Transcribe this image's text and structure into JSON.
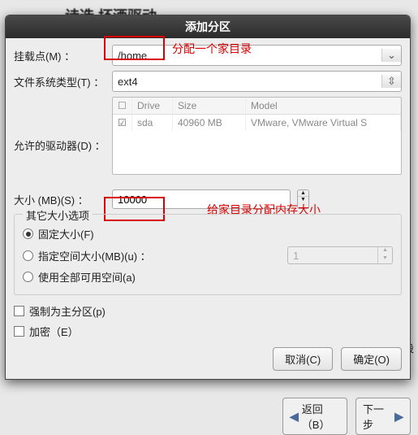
{
  "background": {
    "truncated_title": "诗选 坏酒驱动",
    "back_btn": "返回（B）",
    "next_btn": "下一步",
    "side_label": "设"
  },
  "dialog": {
    "title": "添加分区",
    "mount_label": "挂载点(M) ：",
    "mount_value": "/home",
    "annot_mount": "分配一个家目录",
    "fs_label": "文件系统类型(T) ：",
    "fs_value": "ext4",
    "drives_label": "允许的驱动器(D) ：",
    "drive_table": {
      "head": {
        "c1": "Drive",
        "c2": "Size",
        "c3": "Model"
      },
      "row": {
        "c1": "sda",
        "c2": "40960 MB",
        "c3": "VMware, VMware Virtual S"
      }
    },
    "size_label": "大小 (MB)(S) ：",
    "size_value": "10000",
    "annot_size": "给家目录分配内存大小",
    "size_group": {
      "legend": "其它大小选项",
      "opt_fixed": "固定大小(F)",
      "opt_upto": "指定空间大小(MB)(u) ：",
      "opt_upto_val": "1",
      "opt_all": "使用全部可用空间(a)"
    },
    "force_primary": "强制为主分区(p)",
    "encrypt": "加密（E）",
    "cancel": "取消(C)",
    "ok": "确定(O)"
  }
}
